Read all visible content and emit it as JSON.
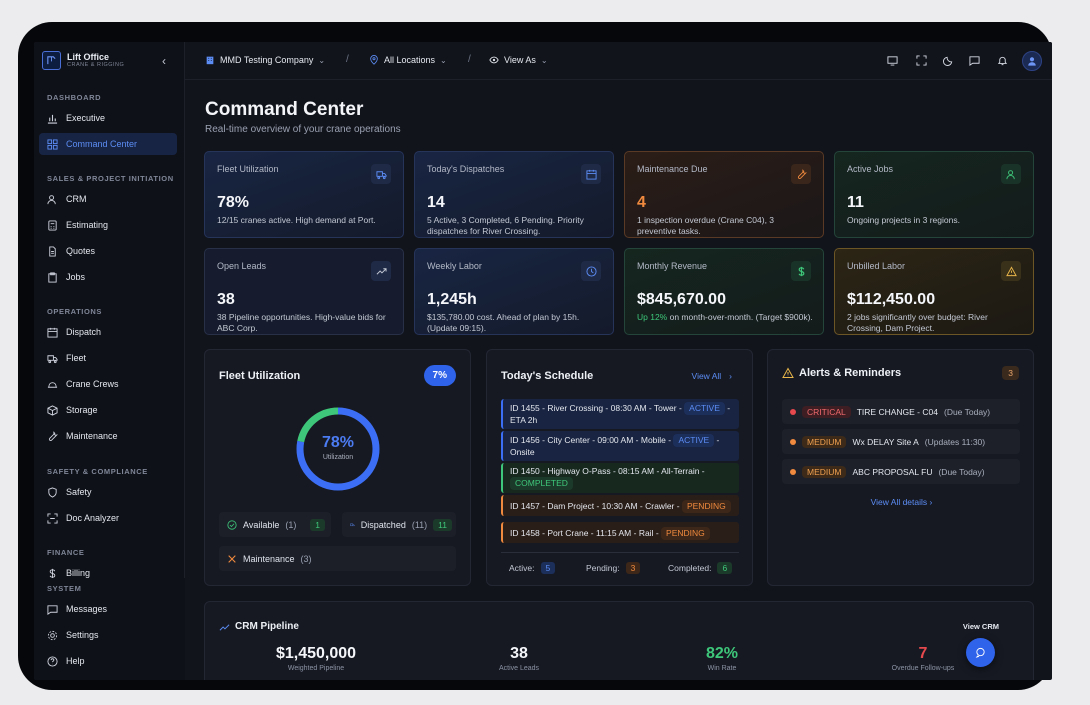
{
  "brand": {
    "name": "Lift Office",
    "subtitle": "CRANE & RIGGING"
  },
  "sidebar": {
    "sections": {
      "dashboard": "DASHBOARD",
      "sales": "SALES & PROJECT INITIATION",
      "operations": "OPERATIONS",
      "safety": "SAFETY & COMPLIANCE",
      "finance": "FINANCE",
      "system": "SYSTEM"
    },
    "items": {
      "executive": "Executive",
      "command_center": "Command Center",
      "crm": "CRM",
      "estimating": "Estimating",
      "quotes": "Quotes",
      "jobs": "Jobs",
      "dispatch": "Dispatch",
      "fleet": "Fleet",
      "crane_crews": "Crane Crews",
      "storage": "Storage",
      "maintenance": "Maintenance",
      "safety": "Safety",
      "doc_analyzer": "Doc Analyzer",
      "billing": "Billing",
      "messages": "Messages",
      "settings": "Settings",
      "help": "Help"
    }
  },
  "topbar": {
    "company": "MMD Testing Company",
    "location": "All Locations",
    "view_as": "View As",
    "separator": "/"
  },
  "page": {
    "title": "Command Center",
    "subtitle": "Real-time overview of your crane operations"
  },
  "cards": {
    "fleet": {
      "label": "Fleet Utilization",
      "value": "78%",
      "desc": "12/15 cranes active. High demand at Port."
    },
    "dispatches": {
      "label": "Today's Dispatches",
      "value": "14",
      "desc": "5 Active, 3 Completed, 6 Pending. Priority dispatches for River Crossing."
    },
    "maintenance": {
      "label": "Maintenance Due",
      "value": "4",
      "desc": "1 inspection overdue (Crane C04), 3 preventive tasks."
    },
    "jobs": {
      "label": "Active Jobs",
      "value": "11",
      "desc": "Ongoing projects in 3 regions."
    },
    "leads": {
      "label": "Open Leads",
      "value": "38",
      "desc": "38 Pipeline opportunities. High-value bids for ABC Corp."
    },
    "labor": {
      "label": "Weekly Labor",
      "value": "1,245h",
      "desc": "$135,780.00 cost. Ahead of plan by 15h. (Update 09:15)."
    },
    "revenue": {
      "label": "Monthly Revenue",
      "value": "$845,670.00",
      "desc_up": "Up 12%",
      "desc": " on month-over-month. (Target $900k)."
    },
    "unbilled": {
      "label": "Unbilled Labor",
      "value": "$112,450.00",
      "desc": "2 jobs significantly over budget: River Crossing, Dam Project."
    }
  },
  "fleet_panel": {
    "title": "Fleet Utilization",
    "badge": "7%",
    "donut_value": "78%",
    "donut_label": "Utilization",
    "utilization_fraction": 0.78,
    "available_label": "Available",
    "available_paren": "(1)",
    "available_count": "1",
    "dispatched_label": "Dispatched",
    "dispatched_paren": "(11)",
    "dispatched_count": "11",
    "maintenance_label": "Maintenance",
    "maintenance_paren": "(3)"
  },
  "schedule": {
    "title": "Today's Schedule",
    "view_all": "View All",
    "rows": [
      {
        "text": "ID 1455 - River Crossing - 08:30 AM - Tower -",
        "status": "ACTIVE",
        "tail": "- ETA 2h"
      },
      {
        "text": "ID 1456 - City Center - 09:00 AM - Mobile -",
        "status": "ACTIVE",
        "tail": "- Onsite"
      },
      {
        "text": "ID 1450 - Highway O-Pass - 08:15 AM - All-Terrain -",
        "status": "COMPLETED",
        "tail": ""
      },
      {
        "text": "ID 1457 - Dam Project - 10:30 AM - Crawler -",
        "status": "PENDING",
        "tail": ""
      },
      {
        "text": "ID 1458 - Port Crane - 11:15 AM - Rail -",
        "status": "PENDING",
        "tail": ""
      }
    ],
    "active_label": "Active:",
    "active_count": "5",
    "pending_label": "Pending:",
    "pending_count": "3",
    "completed_label": "Completed:",
    "completed_count": "6"
  },
  "alerts": {
    "title": "Alerts & Reminders",
    "count": "3",
    "rows": [
      {
        "level": "CRITICAL",
        "text": "TIRE CHANGE - C04",
        "note": "(Due Today)"
      },
      {
        "level": "MEDIUM",
        "text": "Wx DELAY Site A",
        "note": "(Updates 11:30)"
      },
      {
        "level": "MEDIUM",
        "text": "ABC PROPOSAL FU",
        "note": "(Due Today)"
      }
    ],
    "view_details": "View All details"
  },
  "crm": {
    "title": "CRM Pipeline",
    "view_crm": "View CRM",
    "weighted_value": "$1,450,000",
    "weighted_label": "Weighted Pipeline",
    "leads_value": "38",
    "leads_label": "Active Leads",
    "win_value": "82%",
    "win_label": "Win Rate",
    "overdue_value": "7",
    "overdue_label": "Overdue Follow-ups"
  },
  "colors": {
    "accent": "#3b6ef5",
    "green": "#3ec77a",
    "orange": "#f08a3e",
    "red": "#e5484d"
  }
}
